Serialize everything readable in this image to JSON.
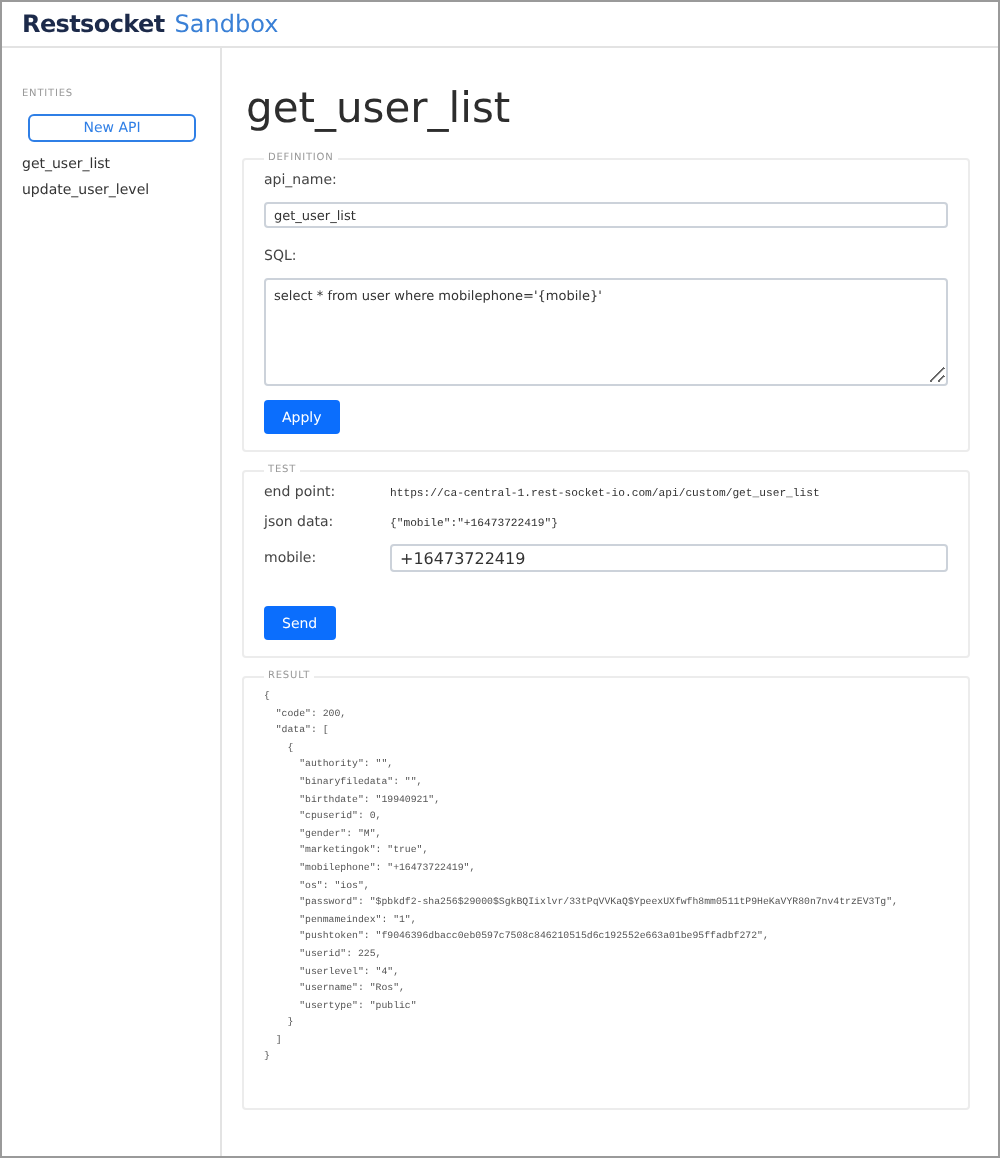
{
  "header": {
    "brand": "Restsocket",
    "product": "Sandbox"
  },
  "sidebar": {
    "heading": "ENTITIES",
    "new_button": "New API",
    "items": [
      {
        "label": "get_user_list"
      },
      {
        "label": "update_user_level"
      }
    ]
  },
  "title": "get_user_list",
  "definition": {
    "legend": "DEFINITION",
    "name_label": "api_name:",
    "name_value": "get_user_list",
    "sql_label": "SQL:",
    "sql_value": "select * from user where mobilephone='{mobile}'",
    "button": "Apply"
  },
  "test": {
    "legend": "TEST",
    "rows": [
      {
        "label": "end point:",
        "value": "https://ca-central-1.rest-socket-io.com/api/custom/get_user_list"
      },
      {
        "label": "json data:",
        "value": "{\"mobile\":\"+16473722419\"}"
      }
    ],
    "param_label": "mobile:",
    "param_value": "+16473722419",
    "button": "Send"
  },
  "result": {
    "legend": "RESULT",
    "lines": [
      "{",
      "  \"code\": 200,",
      "  \"data\": [",
      "    {",
      "      \"authority\": \"\",",
      "      \"binaryfiledata\": \"\",",
      "      \"birthdate\": \"19940921\",",
      "      \"cpuserid\": 0,",
      "      \"gender\": \"M\",",
      "      \"marketingok\": \"true\",",
      "      \"mobilephone\": \"+16473722419\",",
      "      \"os\": \"ios\",",
      "      \"password\": \"$pbkdf2-sha256$29000$SgkBQIixlvr/33tPqVVKaQ$YpeexUXfwfh8mm0511tP9HeKaVYR80n7nv4trzEV3Tg\",",
      "      \"penmameindex\": \"1\",",
      "      \"pushtoken\": \"f9046396dbacc0eb0597c7508c846210515d6c192552e663a01be95ffadbf272\",",
      "      \"userid\": 225,",
      "      \"userlevel\": \"4\",",
      "      \"username\": \"Ros\",",
      "      \"usertype\": \"public\"",
      "    }",
      "  ]",
      "}"
    ]
  }
}
